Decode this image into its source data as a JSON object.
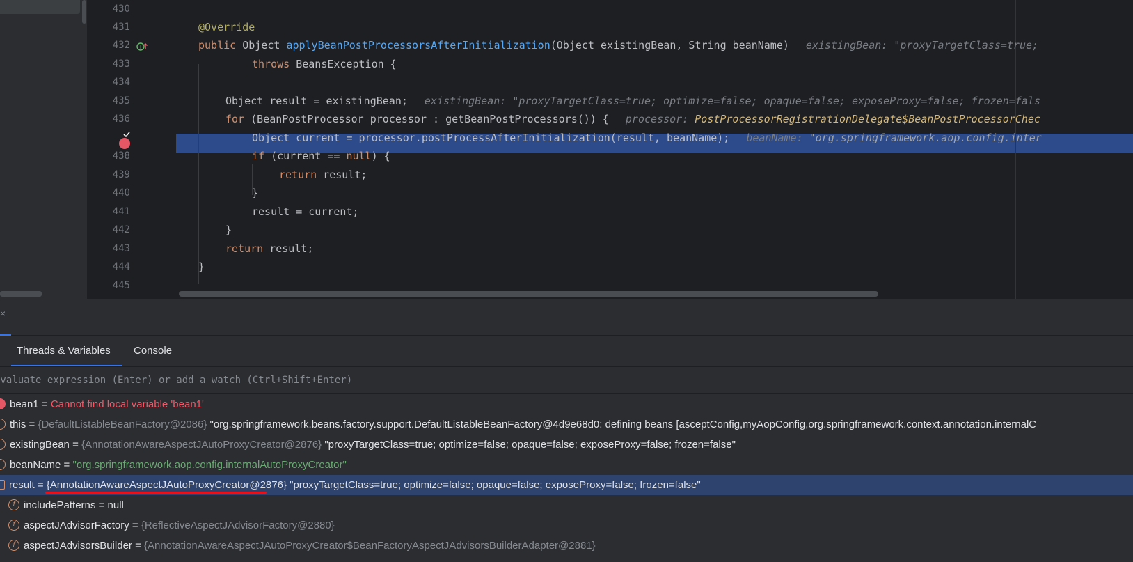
{
  "editor": {
    "line_numbers": [
      "430",
      "431",
      "432",
      "433",
      "434",
      "435",
      "436",
      "",
      "438",
      "439",
      "440",
      "441",
      "442",
      "443",
      "444",
      "445"
    ],
    "lines": {
      "l431": {
        "annotation": "@Override"
      },
      "l432": {
        "kw_public": "public",
        "type_object": " Object ",
        "method": "applyBeanPostProcessorsAfterInitialization",
        "params": "(Object existingBean, String beanName)",
        "hint": "existingBean: \"proxyTargetClass=true;"
      },
      "l433": {
        "kw_throws": "throws",
        "rest": " BeansException {"
      },
      "l435": {
        "code": "Object result = existingBean;",
        "hint": "existingBean: \"proxyTargetClass=true; optimize=false; opaque=false; exposeProxy=false; frozen=fals"
      },
      "l436": {
        "kw_for": "for",
        "code": " (BeanPostProcessor processor : getBeanPostProcessors()) {",
        "hint_label": "processor: ",
        "hint_class": "PostProcessorRegistrationDelegate$BeanPostProcessorChec"
      },
      "l437": {
        "code": "Object current = processor.postProcessAfterInitialization(result, beanName);",
        "hint_label": "beanName: ",
        "hint_value": "\"org.springframework.aop.config.inter"
      },
      "l438": {
        "kw_if": "if",
        "code_a": " (current == ",
        "kw_null": "null",
        "code_b": ") {"
      },
      "l439": {
        "kw_return": "return",
        "code": " result;"
      },
      "l440": {
        "code": "}"
      },
      "l441": {
        "code": "result = current;"
      },
      "l442": {
        "code": "}"
      },
      "l443": {
        "kw_return": "return",
        "code": " result;"
      },
      "l444": {
        "code": "}"
      }
    }
  },
  "debug": {
    "close_glyph": "×",
    "tabs": [
      {
        "label": "Threads & Variables",
        "active": true
      },
      {
        "label": "Console",
        "active": false
      }
    ],
    "watch_placeholder": "Evaluate expression (Enter) or add a watch (Ctrl+Shift+Enter)",
    "variables": [
      {
        "icon": "error-icon",
        "name": "bean1",
        "eq": " = ",
        "error": "Cannot find local variable 'bean1'"
      },
      {
        "icon": "object-icon",
        "name": "this",
        "eq": " = ",
        "type": "{DefaultListableBeanFactory@2086}",
        "value": " \"org.springframework.beans.factory.support.DefaultListableBeanFactory@4d9e68d0: defining beans [asceptConfig,myAopConfig,org.springframework.context.annotation.internalC"
      },
      {
        "icon": "param-icon",
        "name": "existingBean",
        "eq": " = ",
        "type": "{AnnotationAwareAspectJAutoProxyCreator@2876}",
        "value": " \"proxyTargetClass=true; optimize=false; opaque=false; exposeProxy=false; frozen=false\""
      },
      {
        "icon": "param-icon",
        "name": "beanName",
        "eq": " = ",
        "string": "\"org.springframework.aop.config.internalAutoProxyCreator\""
      },
      {
        "icon": "local-var-icon",
        "name": "result",
        "eq": " = ",
        "type": "{AnnotationAwareAspectJAutoProxyCreator@2876}",
        "value": " \"proxyTargetClass=true; optimize=false; opaque=false; exposeProxy=false; frozen=false\""
      },
      {
        "icon": "field-icon",
        "name": "includePatterns",
        "eq": " = ",
        "value": "null"
      },
      {
        "icon": "field-icon",
        "name": "aspectJAdvisorFactory",
        "eq": " = ",
        "type": "{ReflectiveAspectJAdvisorFactory@2880}"
      },
      {
        "icon": "field-icon",
        "name": "aspectJAdvisorsBuilder",
        "eq": " = ",
        "type": "{AnnotationAwareAspectJAutoProxyCreator$BeanFactoryAspectJAdvisorsBuilderAdapter@2881}"
      }
    ],
    "field_glyph": "f"
  },
  "colors": {
    "highlight_line": "#2d4b8a",
    "selected_row": "#2e436e",
    "breakpoint": "#e55765",
    "underline": "#e0141e",
    "accent": "#3574f0"
  }
}
